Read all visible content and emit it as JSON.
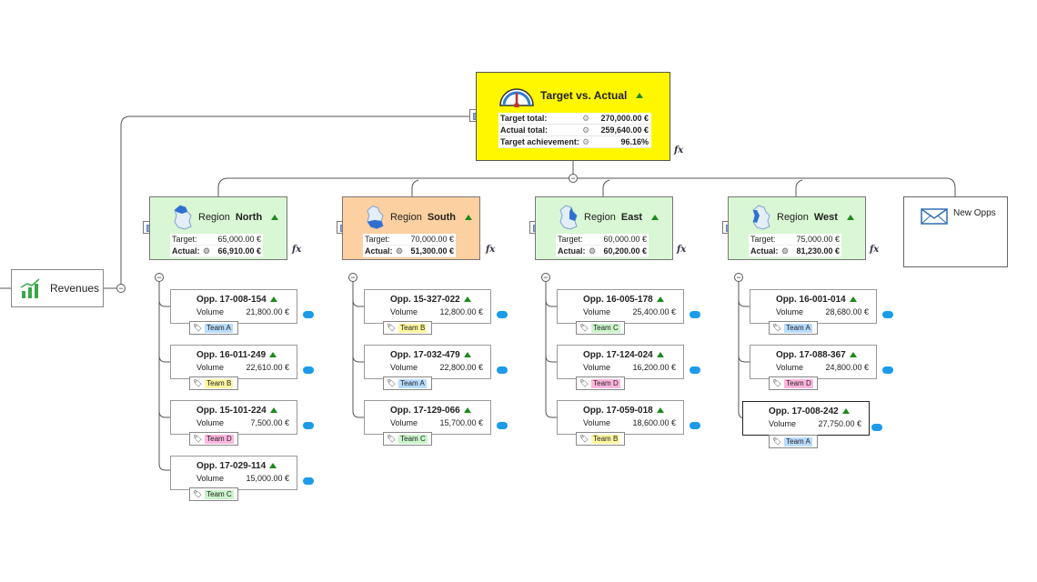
{
  "root": {
    "label": "Revenues",
    "icon": "bar-chart-trend-icon"
  },
  "summary": {
    "title": "Target vs. Actual",
    "icon": "gauge-icon",
    "rows": [
      {
        "label": "Target total:",
        "value": "270,000.00 €"
      },
      {
        "label": "Actual total:",
        "value": "259,640.00 €"
      },
      {
        "label": "Target achievement:",
        "value": "96.16%"
      }
    ],
    "fx": "fx"
  },
  "regions": [
    {
      "prefix": "Region",
      "name": "North",
      "icon": "germany-map-icon",
      "target_label": "Target:",
      "target": "65,000.00 €",
      "actual_label": "Actual:",
      "actual": "66,910.00 €",
      "opps": [
        {
          "id": "Opp. 17-008-154",
          "volume_label": "Volume",
          "volume": "21,800.00 €",
          "team": "Team A"
        },
        {
          "id": "Opp. 16-011-249",
          "volume_label": "Volume",
          "volume": "22,610.00 €",
          "team": "Team B"
        },
        {
          "id": "Opp. 15-101-224",
          "volume_label": "Volume",
          "volume": "7,500.00 €",
          "team": "Team D"
        },
        {
          "id": "Opp. 17-029-114",
          "volume_label": "Volume",
          "volume": "15,000.00 €",
          "team": "Team C"
        }
      ]
    },
    {
      "prefix": "Region",
      "name": "South",
      "icon": "germany-map-icon",
      "target_label": "Target:",
      "target": "70,000.00 €",
      "actual_label": "Actual:",
      "actual": "51,300.00 €",
      "opps": [
        {
          "id": "Opp. 15-327-022",
          "volume_label": "Volume",
          "volume": "12,800.00 €",
          "team": "Team B"
        },
        {
          "id": "Opp. 17-032-479",
          "volume_label": "Volume",
          "volume": "22,800.00 €",
          "team": "Team A"
        },
        {
          "id": "Opp. 17-129-066",
          "volume_label": "Volume",
          "volume": "15,700.00 €",
          "team": "Team C"
        }
      ]
    },
    {
      "prefix": "Region",
      "name": "East",
      "icon": "germany-map-icon",
      "target_label": "Target:",
      "target": "60,000.00 €",
      "actual_label": "Actual:",
      "actual": "60,200.00 €",
      "opps": [
        {
          "id": "Opp. 16-005-178",
          "volume_label": "Volume",
          "volume": "25,400.00 €",
          "team": "Team C"
        },
        {
          "id": "Opp. 17-124-024",
          "volume_label": "Volume",
          "volume": "16,200.00 €",
          "team": "Team D"
        },
        {
          "id": "Opp. 17-059-018",
          "volume_label": "Volume",
          "volume": "18,600.00 €",
          "team": "Team B"
        }
      ]
    },
    {
      "prefix": "Region",
      "name": "West",
      "icon": "germany-map-icon",
      "target_label": "Target:",
      "target": "75,000.00 €",
      "actual_label": "Actual:",
      "actual": "81,230.00 €",
      "opps": [
        {
          "id": "Opp. 16-001-014",
          "volume_label": "Volume",
          "volume": "28,680.00 €",
          "team": "Team A"
        },
        {
          "id": "Opp. 17-088-367",
          "volume_label": "Volume",
          "volume": "24,800.00 €",
          "team": "Team D"
        },
        {
          "id": "Opp. 17-008-242",
          "volume_label": "Volume",
          "volume": "27,750.00 €",
          "team": "Team A"
        }
      ]
    }
  ],
  "new_opps": {
    "label": "New Opps",
    "icon": "envelope-icon"
  },
  "colors": {
    "summary_bg": "#fff700",
    "region_bg": "#d9f7d4",
    "region_south_bg": "#fcd0a0",
    "team_a": "#b9dcff",
    "team_b": "#fff6a0",
    "team_c": "#caf5ca",
    "team_d": "#ffb6df",
    "salesforce": "#1b9be8",
    "expand_arrow": "#1d8a1d"
  }
}
